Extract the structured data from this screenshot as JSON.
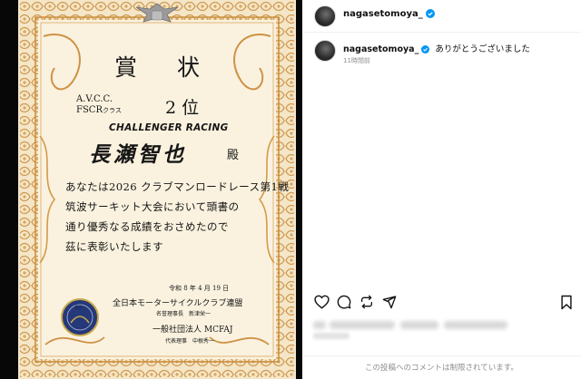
{
  "certificate": {
    "title": "賞 状",
    "organization": "A.V.C.C.",
    "class_name": "FSCR",
    "class_suffix": "クラス",
    "rank": "2 位",
    "team": "CHALLENGER RACING",
    "recipient": "長瀬智也",
    "honorific": "殿",
    "body_lines": [
      "あなたは2026 クラブマンロードレース第1戦",
      "筑波サーキット大会において頭書の",
      "通り優秀なる成績をおさめたので",
      "茲に表彰いたします"
    ],
    "date": "令和 8 年 4 月 19 日",
    "federation": "全日本モーターサイクルクラブ連盟",
    "chair": "名誉理事長　新津栄一",
    "general_incorporated": "一般社団法人 MCFAJ",
    "representative": "代表理事　中根秀一",
    "badge_number": "68",
    "badge_colors": {
      "navy": "#24387a",
      "gold": "#c9a94a"
    }
  },
  "post": {
    "username": "nagasetomoya_",
    "verified": true,
    "verified_color": "#0095f6",
    "comment": {
      "username": "nagasetomoya_",
      "text": "ありがとうございました",
      "time": "11時間前"
    },
    "actions": [
      "heart-icon",
      "comment-icon",
      "repost-icon",
      "send-icon",
      "bookmark-icon"
    ],
    "footer_note": "この投稿へのコメントは制限されています。"
  }
}
